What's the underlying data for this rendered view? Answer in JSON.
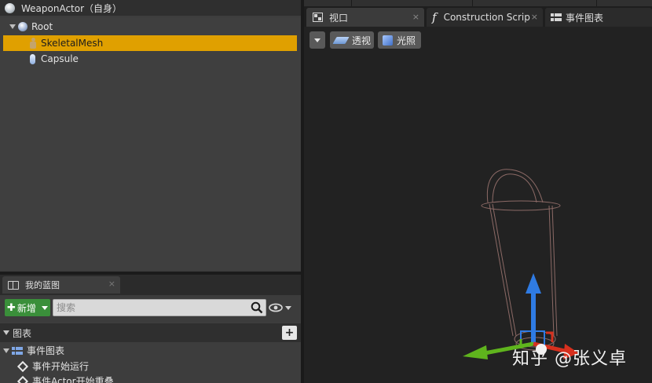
{
  "components": {
    "header_title": "WeaponActor（自身）",
    "tree": [
      {
        "label": "Root"
      },
      {
        "label": "SkeletalMesh"
      },
      {
        "label": "Capsule"
      }
    ]
  },
  "my_blueprint": {
    "tab_label": "我的蓝图",
    "tab_close": "×",
    "new_button_label": "新增",
    "search_placeholder": "搜索",
    "graphs_section": "图表",
    "add_graph": "+",
    "items": [
      {
        "label": "事件图表"
      },
      {
        "label": "事件开始运行"
      },
      {
        "label": "事件Actor开始重叠"
      }
    ]
  },
  "editor_tabs": [
    {
      "label": "视口",
      "close": "×"
    },
    {
      "label": "Construction Scrip",
      "close": "×"
    },
    {
      "label": "事件图表"
    }
  ],
  "viewport": {
    "perspective_label": "透视",
    "lit_label": "光照"
  },
  "watermark": "知乎 @张义卓",
  "colors": {
    "selection": "#e0a000",
    "new_button": "#3a8f3a",
    "gizmo_z": "#2f7be3",
    "gizmo_x": "#d6301e",
    "gizmo_y": "#5fb41d",
    "capsule_wire": "#8c6a66"
  }
}
